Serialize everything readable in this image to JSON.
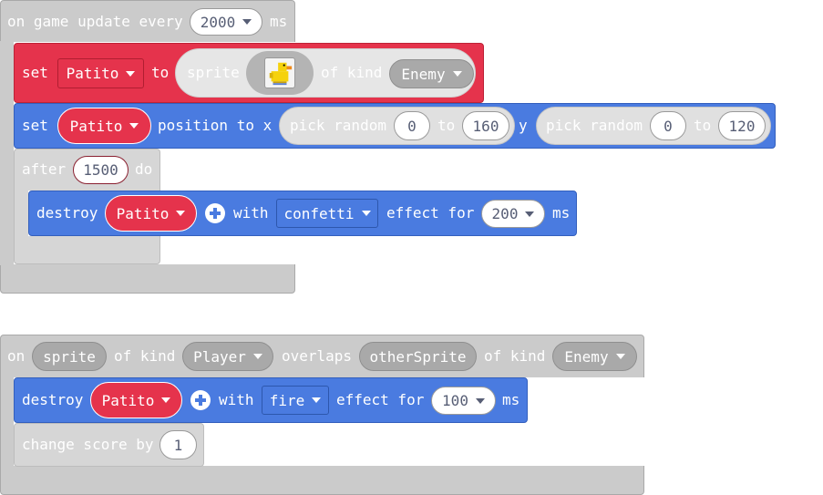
{
  "event1": {
    "text_on_update": "on game update every",
    "interval": "2000",
    "text_ms": "ms",
    "set_block": {
      "text_set": "set",
      "variable": "Patito",
      "text_to": "to",
      "text_sprite": "sprite",
      "sprite_image": "duck-sprite",
      "text_of_kind": "of kind",
      "kind": "Enemy"
    },
    "position_block": {
      "text_set": "set",
      "variable": "Patito",
      "text_position": "position to x",
      "text_pick_random": "pick random",
      "x_min": "0",
      "text_to": "to",
      "x_max": "160",
      "text_y": "y",
      "y_min": "0",
      "y_max": "120"
    },
    "after_block": {
      "text_after": "after",
      "delay": "1500",
      "text_do": "do"
    },
    "destroy_block": {
      "text_destroy": "destroy",
      "variable": "Patito",
      "text_with": "with",
      "effect": "confetti",
      "text_effect_for": "effect for",
      "duration": "200",
      "text_ms": "ms"
    }
  },
  "event2": {
    "text_on": "on",
    "param1": "sprite",
    "text_of_kind": "of kind",
    "kind1": "Player",
    "text_overlaps": "overlaps",
    "param2": "otherSprite",
    "kind2": "Enemy",
    "destroy_block": {
      "text_destroy": "destroy",
      "variable": "Patito",
      "text_with": "with",
      "effect": "fire",
      "text_effect_for": "effect for",
      "duration": "100",
      "text_ms": "ms"
    },
    "score_block": {
      "text_change_score": "change score by",
      "amount": "1"
    }
  },
  "colors": {
    "event_gray": "#cbcbcb",
    "sprite_red": "#e5334c",
    "sprite_blue": "#4a7be0"
  }
}
